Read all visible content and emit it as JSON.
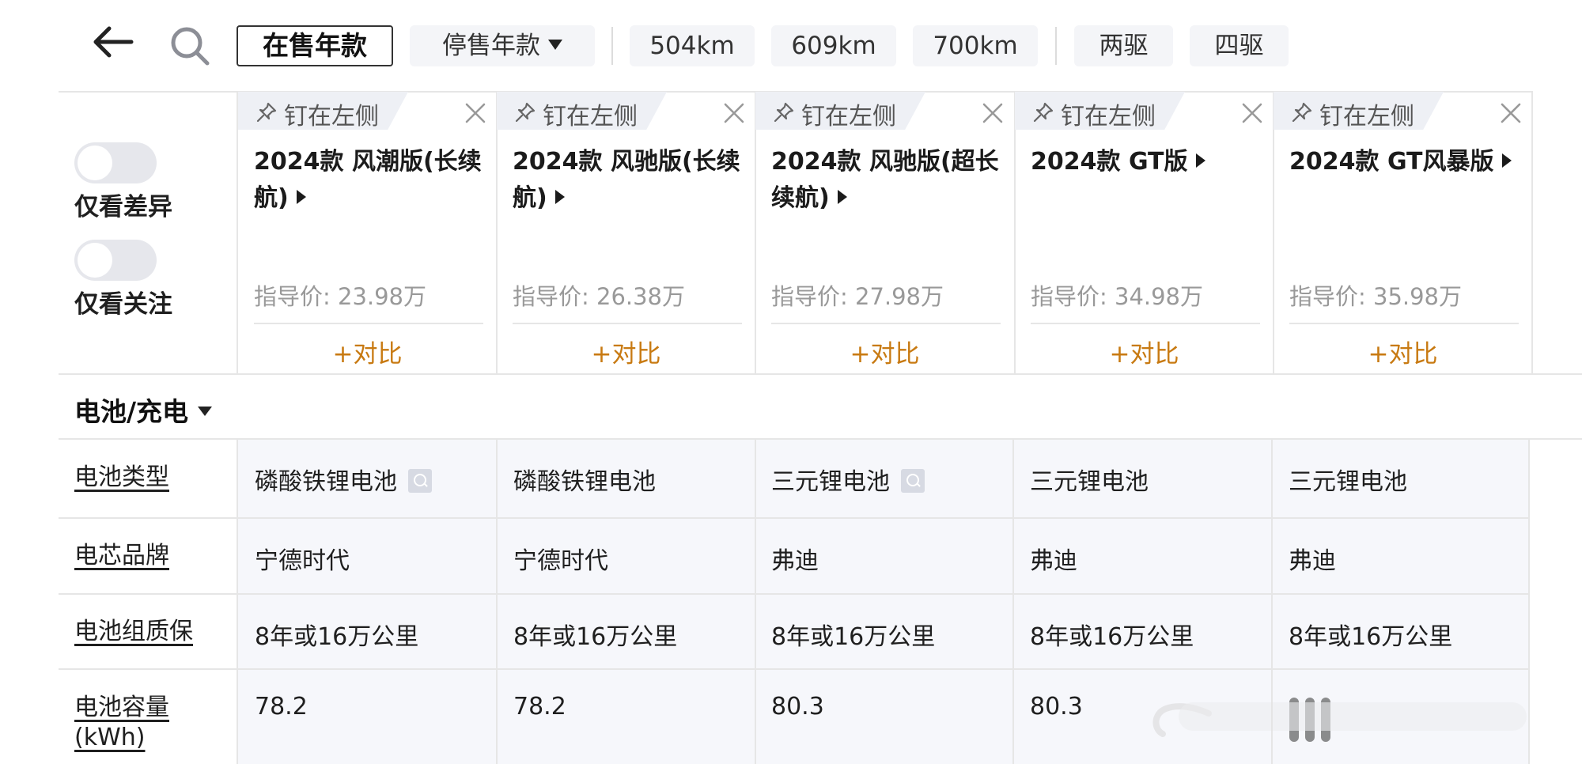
{
  "filters": {
    "on_sale": "在售年款",
    "discontinued": "停售年款",
    "range_504": "504km",
    "range_609": "609km",
    "range_700": "700km",
    "drive_2wd": "两驱",
    "drive_4wd": "四驱"
  },
  "toggles": {
    "diff_only": "仅看差异",
    "focus_only": "仅看关注"
  },
  "cards": [
    {
      "pin": "钉在左侧",
      "title": "2024款 风潮版(长续航)",
      "price": "指导价:  23.98万",
      "compare": "+对比"
    },
    {
      "pin": "钉在左侧",
      "title": "2024款 风驰版(长续航)",
      "price": "指导价:  26.38万",
      "compare": "+对比"
    },
    {
      "pin": "钉在左侧",
      "title": "2024款 风驰版(超长续航)",
      "price": "指导价:  27.98万",
      "compare": "+对比"
    },
    {
      "pin": "钉在左侧",
      "title": "2024款 GT版",
      "price": "指导价:  34.98万",
      "compare": "+对比"
    },
    {
      "pin": "钉在左侧",
      "title": "2024款 GT风暴版",
      "price": "指导价:  35.98万",
      "compare": "+对比"
    }
  ],
  "section": {
    "title": "电池/充电"
  },
  "rows": [
    {
      "label": "电池类型",
      "values": [
        "磷酸铁锂电池",
        "磷酸铁锂电池",
        "三元锂电池",
        "三元锂电池",
        "三元锂电池"
      ]
    },
    {
      "label": "电芯品牌",
      "values": [
        "宁德时代",
        "宁德时代",
        "弗迪",
        "弗迪",
        "弗迪"
      ]
    },
    {
      "label": "电池组质保",
      "values": [
        "8年或16万公里",
        "8年或16万公里",
        "8年或16万公里",
        "8年或16万公里",
        "8年或16万公里"
      ]
    },
    {
      "label": "电池容量(kWh)",
      "label_line1": "电池容量",
      "label_line2": "(kWh)",
      "values": [
        "78.2",
        "78.2",
        "80.3",
        "80.3",
        ""
      ]
    }
  ],
  "colors": {
    "accent": "#c87a12",
    "table_bg": "#f6f7fb",
    "chip_bg": "#f4f5f8"
  }
}
